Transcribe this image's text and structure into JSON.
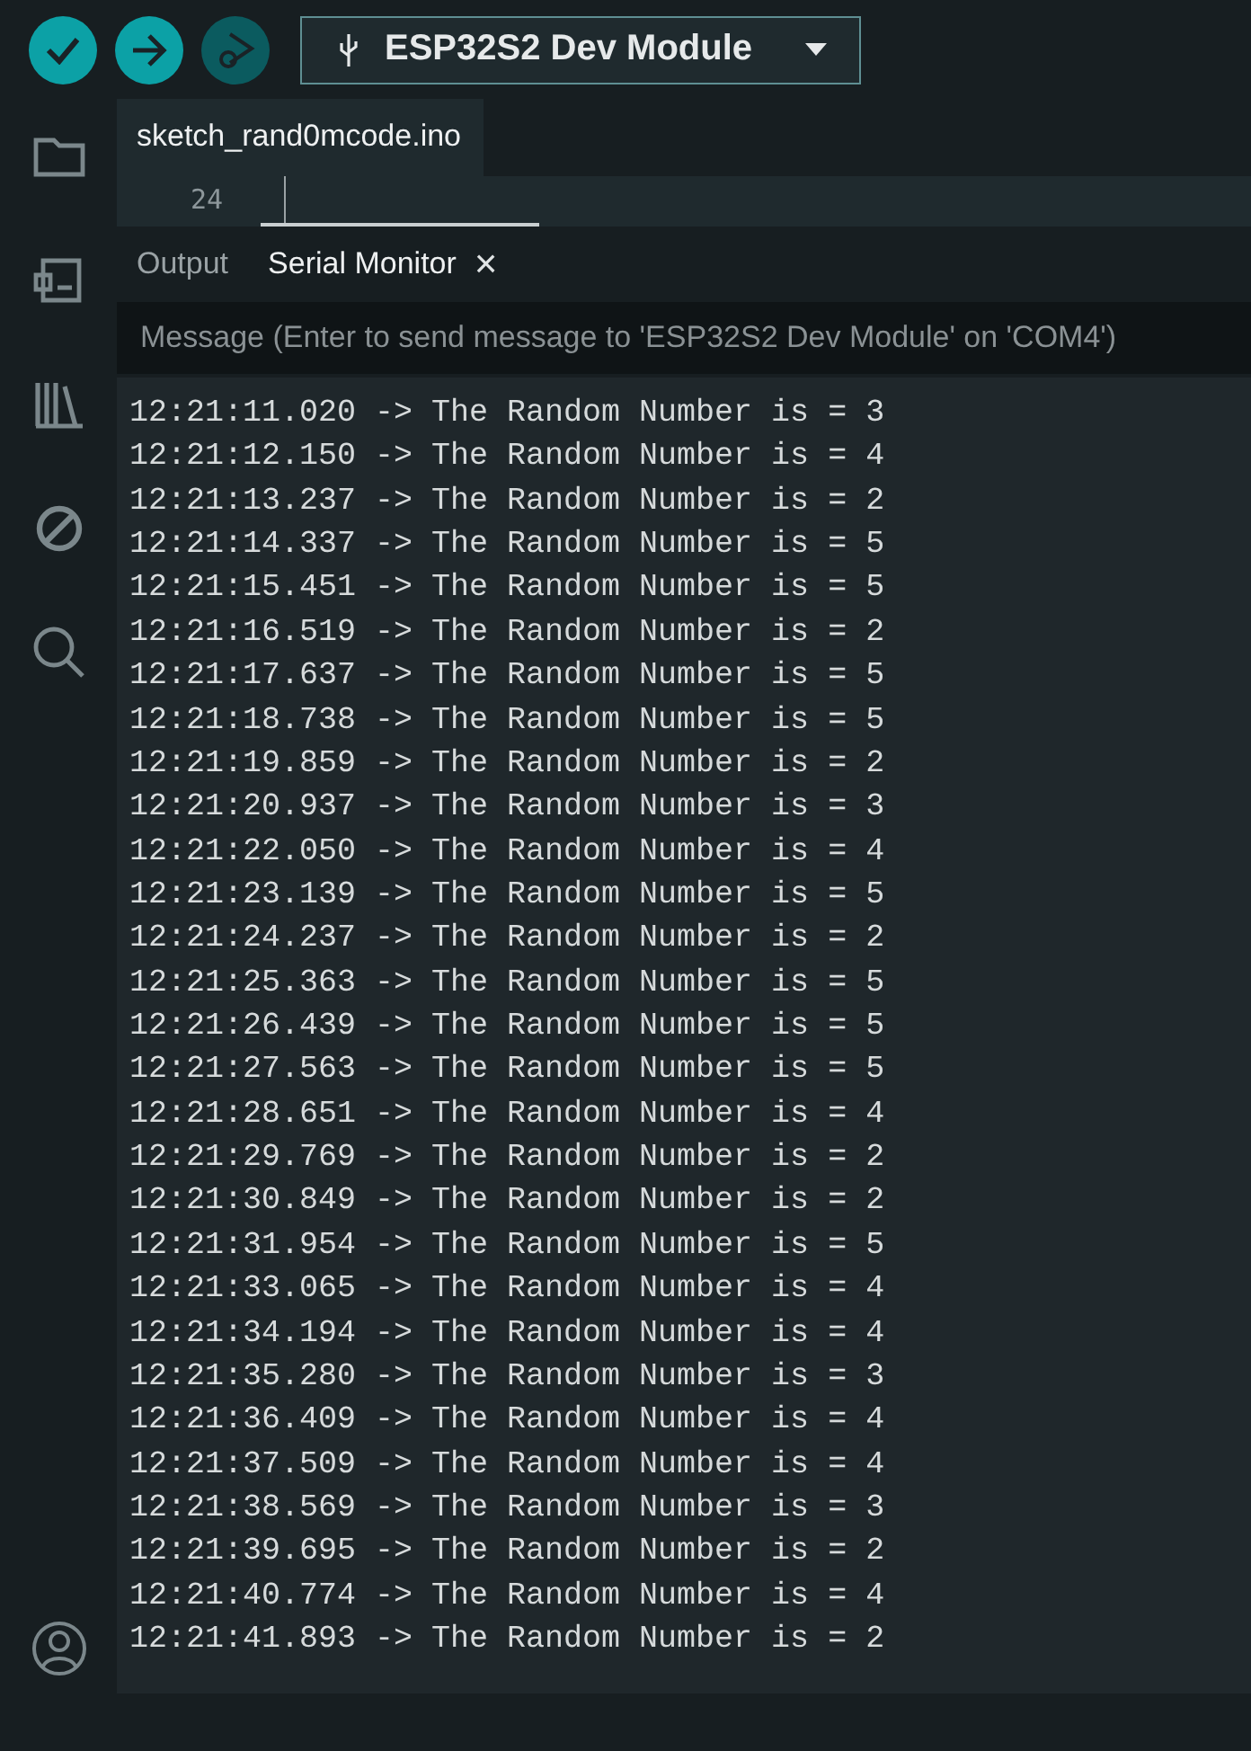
{
  "toolbar": {
    "buttons": [
      {
        "kind": "verify",
        "disabled": false
      },
      {
        "kind": "upload",
        "disabled": false
      },
      {
        "kind": "debug",
        "disabled": true
      }
    ],
    "board_selector": {
      "label": "ESP32S2 Dev Module"
    }
  },
  "sidebar": {
    "items": [
      {
        "kind": "sketchbook"
      },
      {
        "kind": "boards"
      },
      {
        "kind": "library"
      },
      {
        "kind": "debug"
      },
      {
        "kind": "search"
      }
    ],
    "account": {
      "kind": "account"
    }
  },
  "editor": {
    "tabs": [
      {
        "label": "sketch_rand0mcode.ino",
        "selected": true
      }
    ],
    "line_number": "24"
  },
  "panel": {
    "tabs": [
      {
        "label": "Output",
        "selected": false,
        "closable": false
      },
      {
        "label": "Serial Monitor",
        "selected": true,
        "closable": true
      }
    ],
    "close_glyph": "×",
    "message_field": {
      "placeholder": "Message (Enter to send message to 'ESP32S2 Dev Module' on 'COM4')"
    },
    "log_lines": [
      "12:21:11.020 -> The Random Number is = 3",
      "12:21:12.150 -> The Random Number is = 4",
      "12:21:13.237 -> The Random Number is = 2",
      "12:21:14.337 -> The Random Number is = 5",
      "12:21:15.451 -> The Random Number is = 5",
      "12:21:16.519 -> The Random Number is = 2",
      "12:21:17.637 -> The Random Number is = 5",
      "12:21:18.738 -> The Random Number is = 5",
      "12:21:19.859 -> The Random Number is = 2",
      "12:21:20.937 -> The Random Number is = 3",
      "12:21:22.050 -> The Random Number is = 4",
      "12:21:23.139 -> The Random Number is = 5",
      "12:21:24.237 -> The Random Number is = 2",
      "12:21:25.363 -> The Random Number is = 5",
      "12:21:26.439 -> The Random Number is = 5",
      "12:21:27.563 -> The Random Number is = 5",
      "12:21:28.651 -> The Random Number is = 4",
      "12:21:29.769 -> The Random Number is = 2",
      "12:21:30.849 -> The Random Number is = 2",
      "12:21:31.954 -> The Random Number is = 5",
      "12:21:33.065 -> The Random Number is = 4",
      "12:21:34.194 -> The Random Number is = 4",
      "12:21:35.280 -> The Random Number is = 3",
      "12:21:36.409 -> The Random Number is = 4",
      "12:21:37.509 -> The Random Number is = 4",
      "12:21:38.569 -> The Random Number is = 3",
      "12:21:39.695 -> The Random Number is = 2",
      "12:21:40.774 -> The Random Number is = 4",
      "12:21:41.893 -> The Random Number is = 2"
    ]
  }
}
